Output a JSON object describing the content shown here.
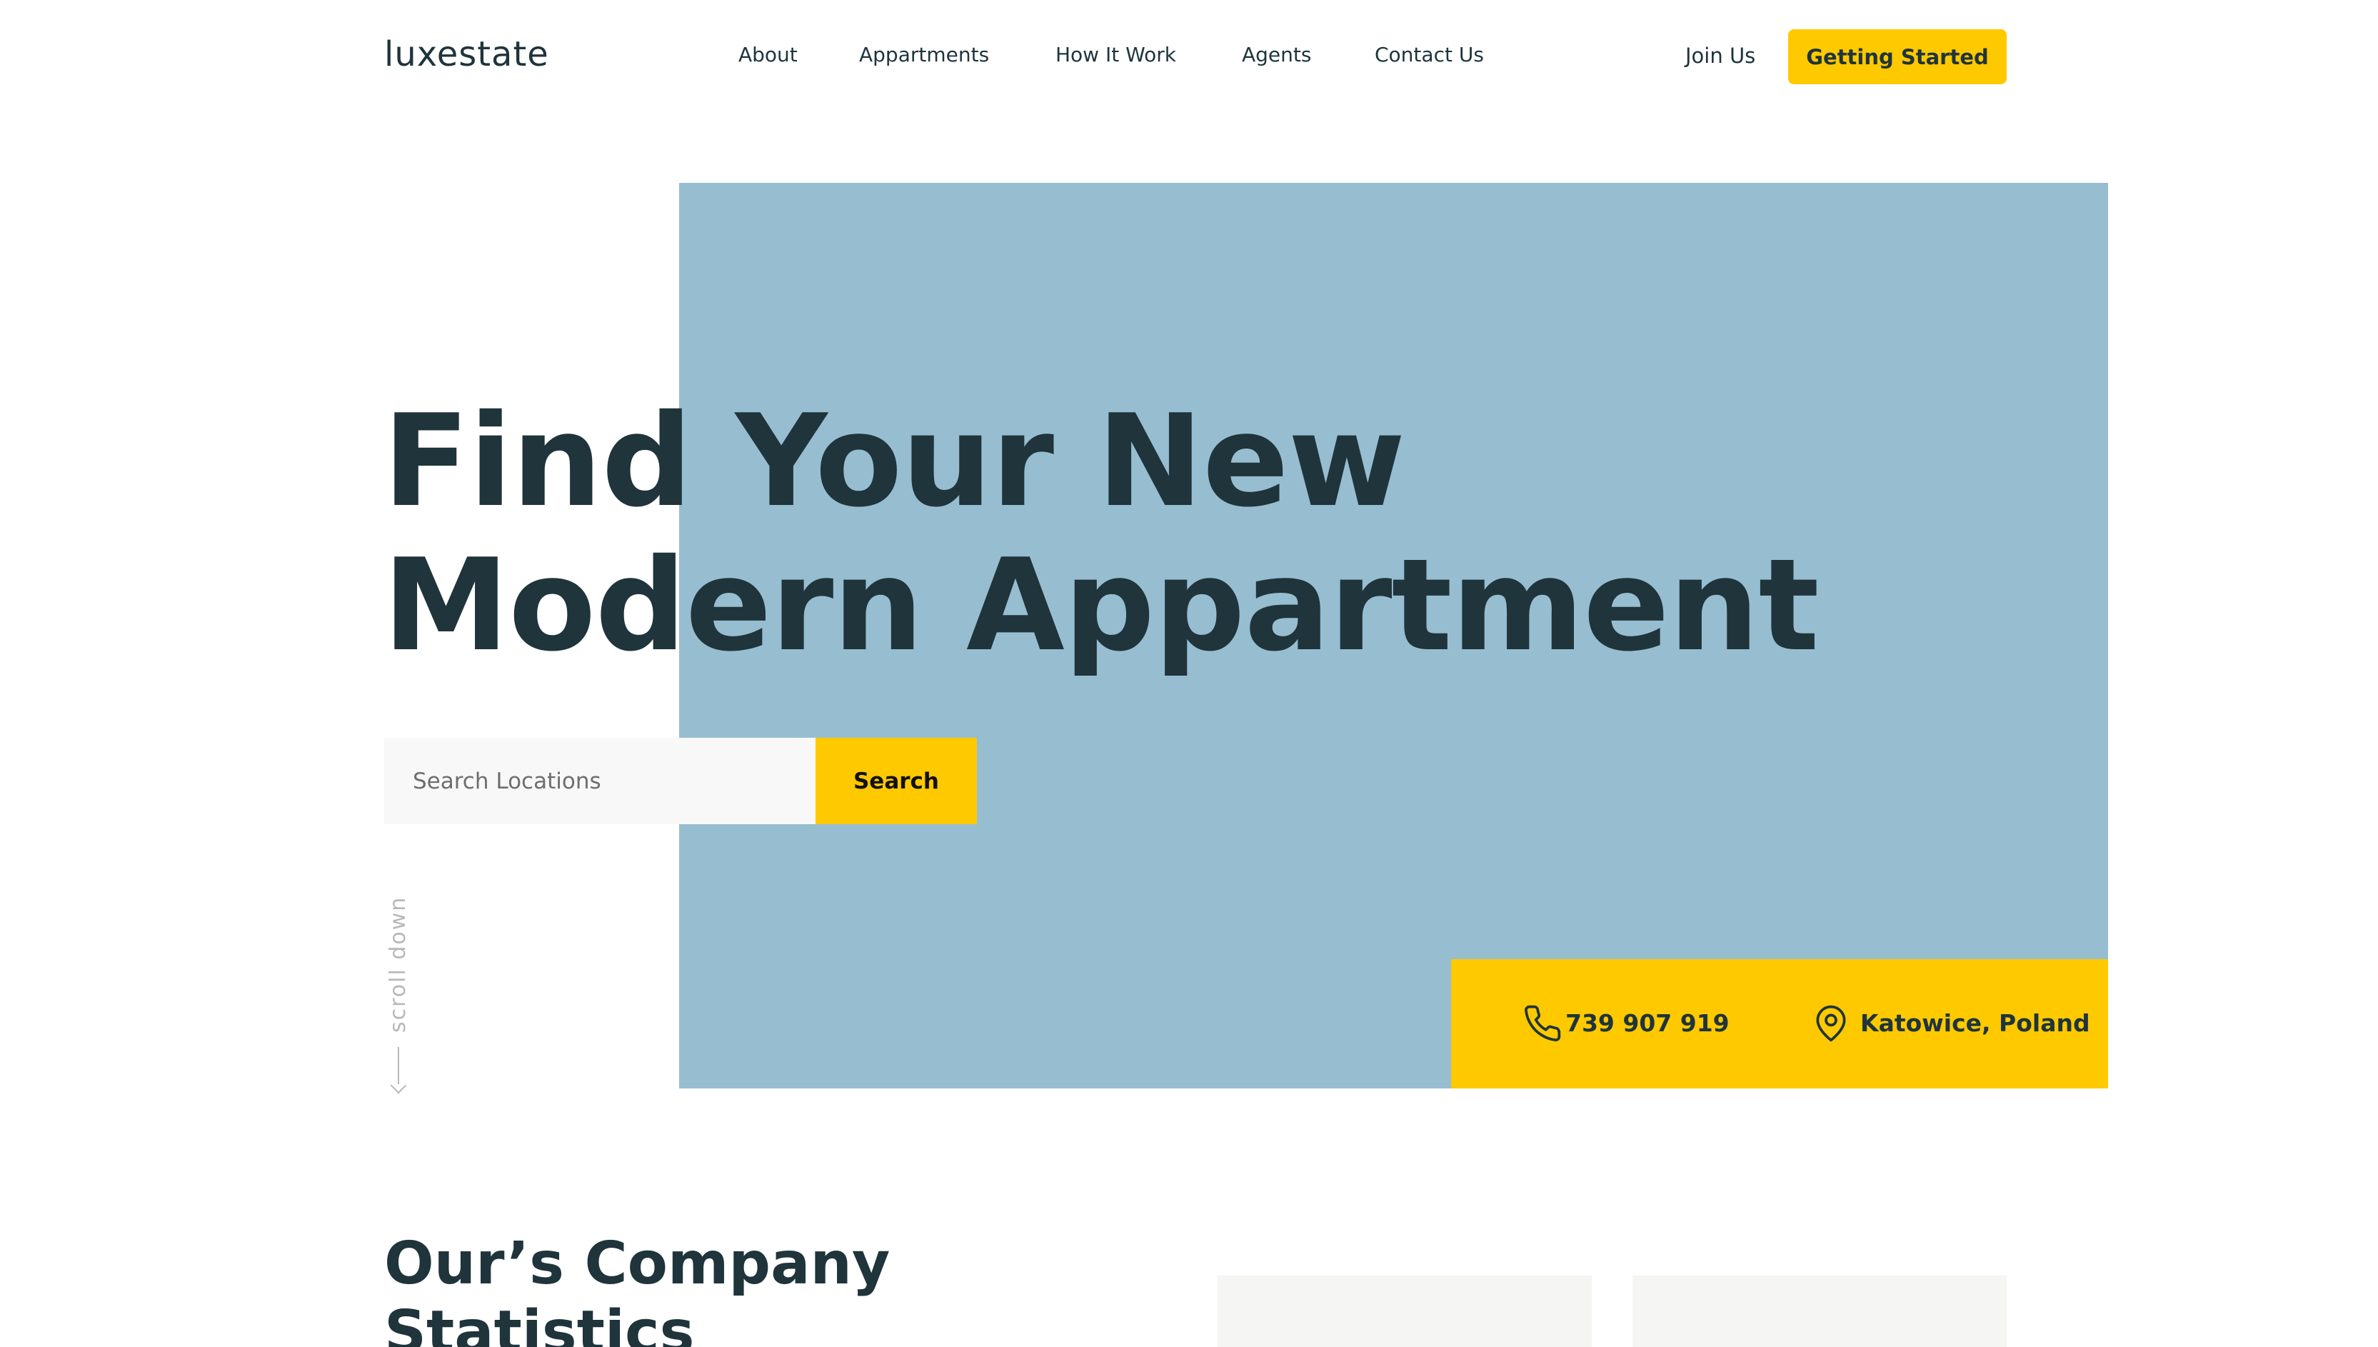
{
  "brand": {
    "logo": "luxestate"
  },
  "nav": {
    "items": [
      "About",
      "Appartments",
      "How It Work",
      "Agents",
      "Contact Us"
    ]
  },
  "header": {
    "join_label": "Join Us",
    "cta_label": "Getting Started"
  },
  "hero": {
    "title_line1": "Find Your New",
    "title_line2": "Modern Appartment",
    "search_placeholder": "Search Locations",
    "search_button": "Search",
    "scroll_label": "scroll down"
  },
  "contact": {
    "phone": "739 907 919",
    "location": "Katowice, Poland"
  },
  "stats": {
    "title_line1": "Our’s Company",
    "title_line2": "Statistics",
    "cards": [
      {
        "value": ""
      },
      {
        "value": ""
      }
    ]
  },
  "colors": {
    "accent": "#ffc900",
    "hero_bg": "#97bdd0",
    "text": "#1f343b",
    "card_bg": "#f5f5f3"
  }
}
